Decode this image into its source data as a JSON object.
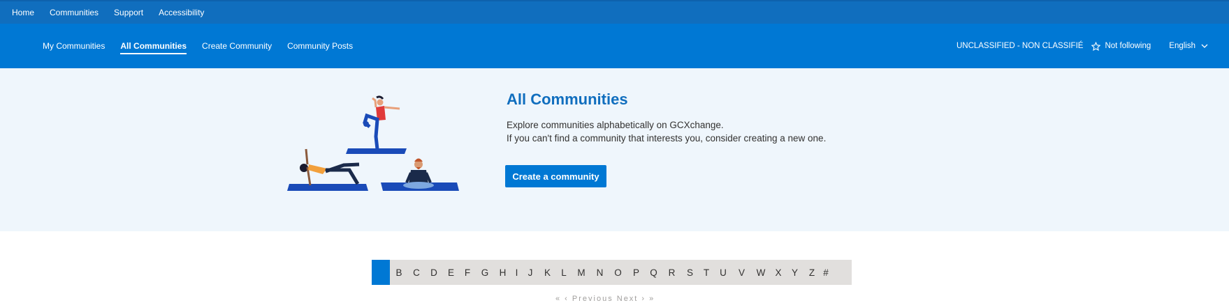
{
  "top_nav": [
    "Home",
    "Communities",
    "Support",
    "Accessibility"
  ],
  "sub_nav": {
    "items": [
      "My Communities",
      "All Communities",
      "Create Community",
      "Community Posts"
    ],
    "active": "All Communities"
  },
  "header_tools": {
    "classification": "UNCLASSIFIED - NON CLASSIFIÉ",
    "follow_label": "Not following",
    "language": "English"
  },
  "hero": {
    "title": "All Communities",
    "line1": "Explore communities alphabetically on GCXchange.",
    "line2": "If you can't find a community that interests you, consider creating a new one.",
    "button": "Create a community"
  },
  "alphabet": [
    "B",
    "C",
    "D",
    "E",
    "F",
    "G",
    "H",
    "I",
    "J",
    "K",
    "L",
    "M",
    "N",
    "O",
    "P",
    "Q",
    "R",
    "S",
    "T",
    "U",
    "V",
    "W",
    "X",
    "Y",
    "Z",
    "#"
  ],
  "pager_text": "« ‹ Previous Next › »",
  "colors": {
    "top_bar": "#106ebe",
    "sub_bar": "#0078d4",
    "hero_bg": "#eff6fc",
    "accent": "#0078d4"
  }
}
